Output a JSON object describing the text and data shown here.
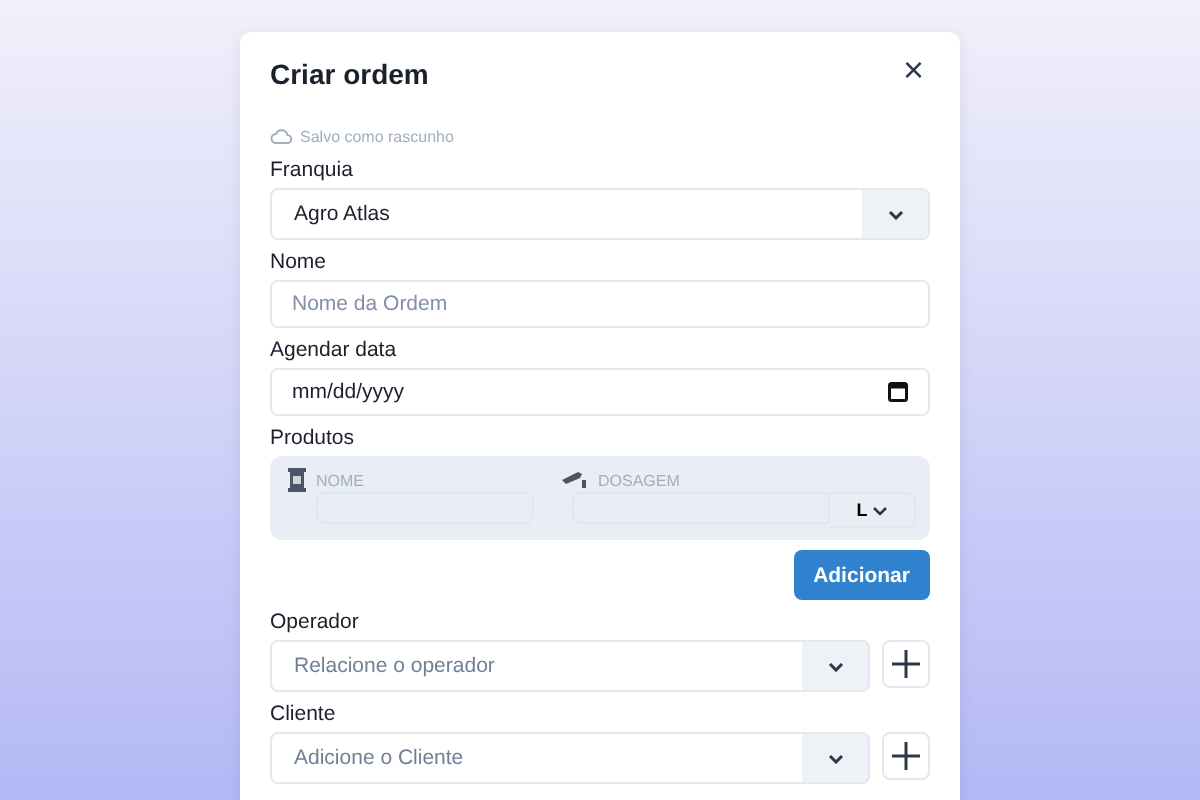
{
  "dialog": {
    "title": "Criar ordem",
    "close": "×",
    "save_status": "Salvo como rascunho"
  },
  "fields": [
    {
      "kind": "select",
      "label": "Franquia",
      "value": "Agro Atlas",
      "add": false
    },
    {
      "kind": "text",
      "label": "Nome",
      "placeholder": "Nome da Ordem"
    },
    {
      "kind": "date",
      "label": "Agendar data",
      "value": "mm/dd/yyyy"
    },
    {
      "kind": "products",
      "label": "Produtos",
      "name_label": "NOME",
      "dose_label": "DOSAGEM",
      "unit": "L",
      "button": "Adicionar"
    },
    {
      "kind": "select",
      "label": "Operador",
      "placeholder": "Relacione o operador",
      "add": true
    },
    {
      "kind": "select",
      "label": "Cliente",
      "placeholder": "Adicione o Cliente",
      "add": true
    }
  ]
}
